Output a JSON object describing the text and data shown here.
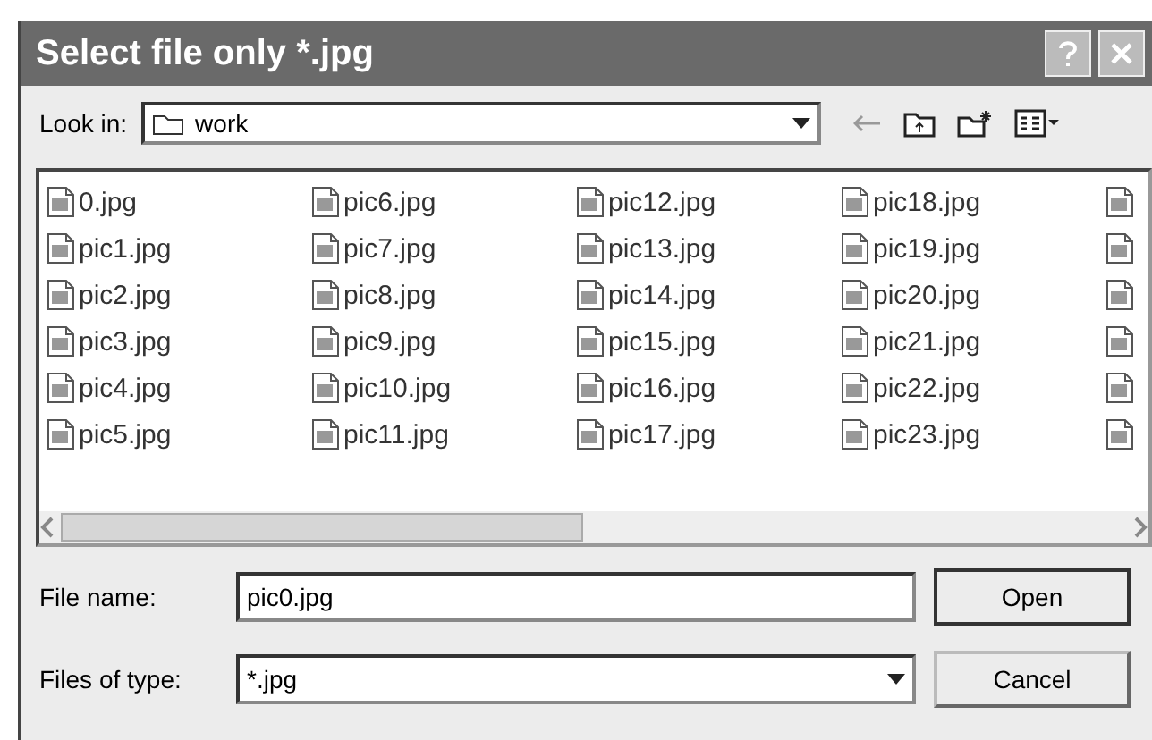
{
  "window": {
    "title": "Select file only *.jpg"
  },
  "look_in": {
    "label": "Look in:",
    "value": "work"
  },
  "files": [
    {
      "name": "0.jpg"
    },
    {
      "name": "pic1.jpg"
    },
    {
      "name": "pic2.jpg"
    },
    {
      "name": "pic3.jpg"
    },
    {
      "name": "pic4.jpg"
    },
    {
      "name": "pic5.jpg"
    },
    {
      "name": "pic6.jpg"
    },
    {
      "name": "pic7.jpg"
    },
    {
      "name": "pic8.jpg"
    },
    {
      "name": "pic9.jpg"
    },
    {
      "name": "pic10.jpg"
    },
    {
      "name": "pic11.jpg"
    },
    {
      "name": "pic12.jpg"
    },
    {
      "name": "pic13.jpg"
    },
    {
      "name": "pic14.jpg"
    },
    {
      "name": "pic15.jpg"
    },
    {
      "name": "pic16.jpg"
    },
    {
      "name": "pic17.jpg"
    },
    {
      "name": "pic18.jpg"
    },
    {
      "name": "pic19.jpg"
    },
    {
      "name": "pic20.jpg"
    },
    {
      "name": "pic21.jpg"
    },
    {
      "name": "pic22.jpg"
    },
    {
      "name": "pic23.jpg"
    }
  ],
  "file_name": {
    "label": "File name:",
    "value": "pic0.jpg"
  },
  "file_type": {
    "label": "Files of type:",
    "value": "*.jpg"
  },
  "buttons": [
    "Open",
    "Cancel"
  ]
}
